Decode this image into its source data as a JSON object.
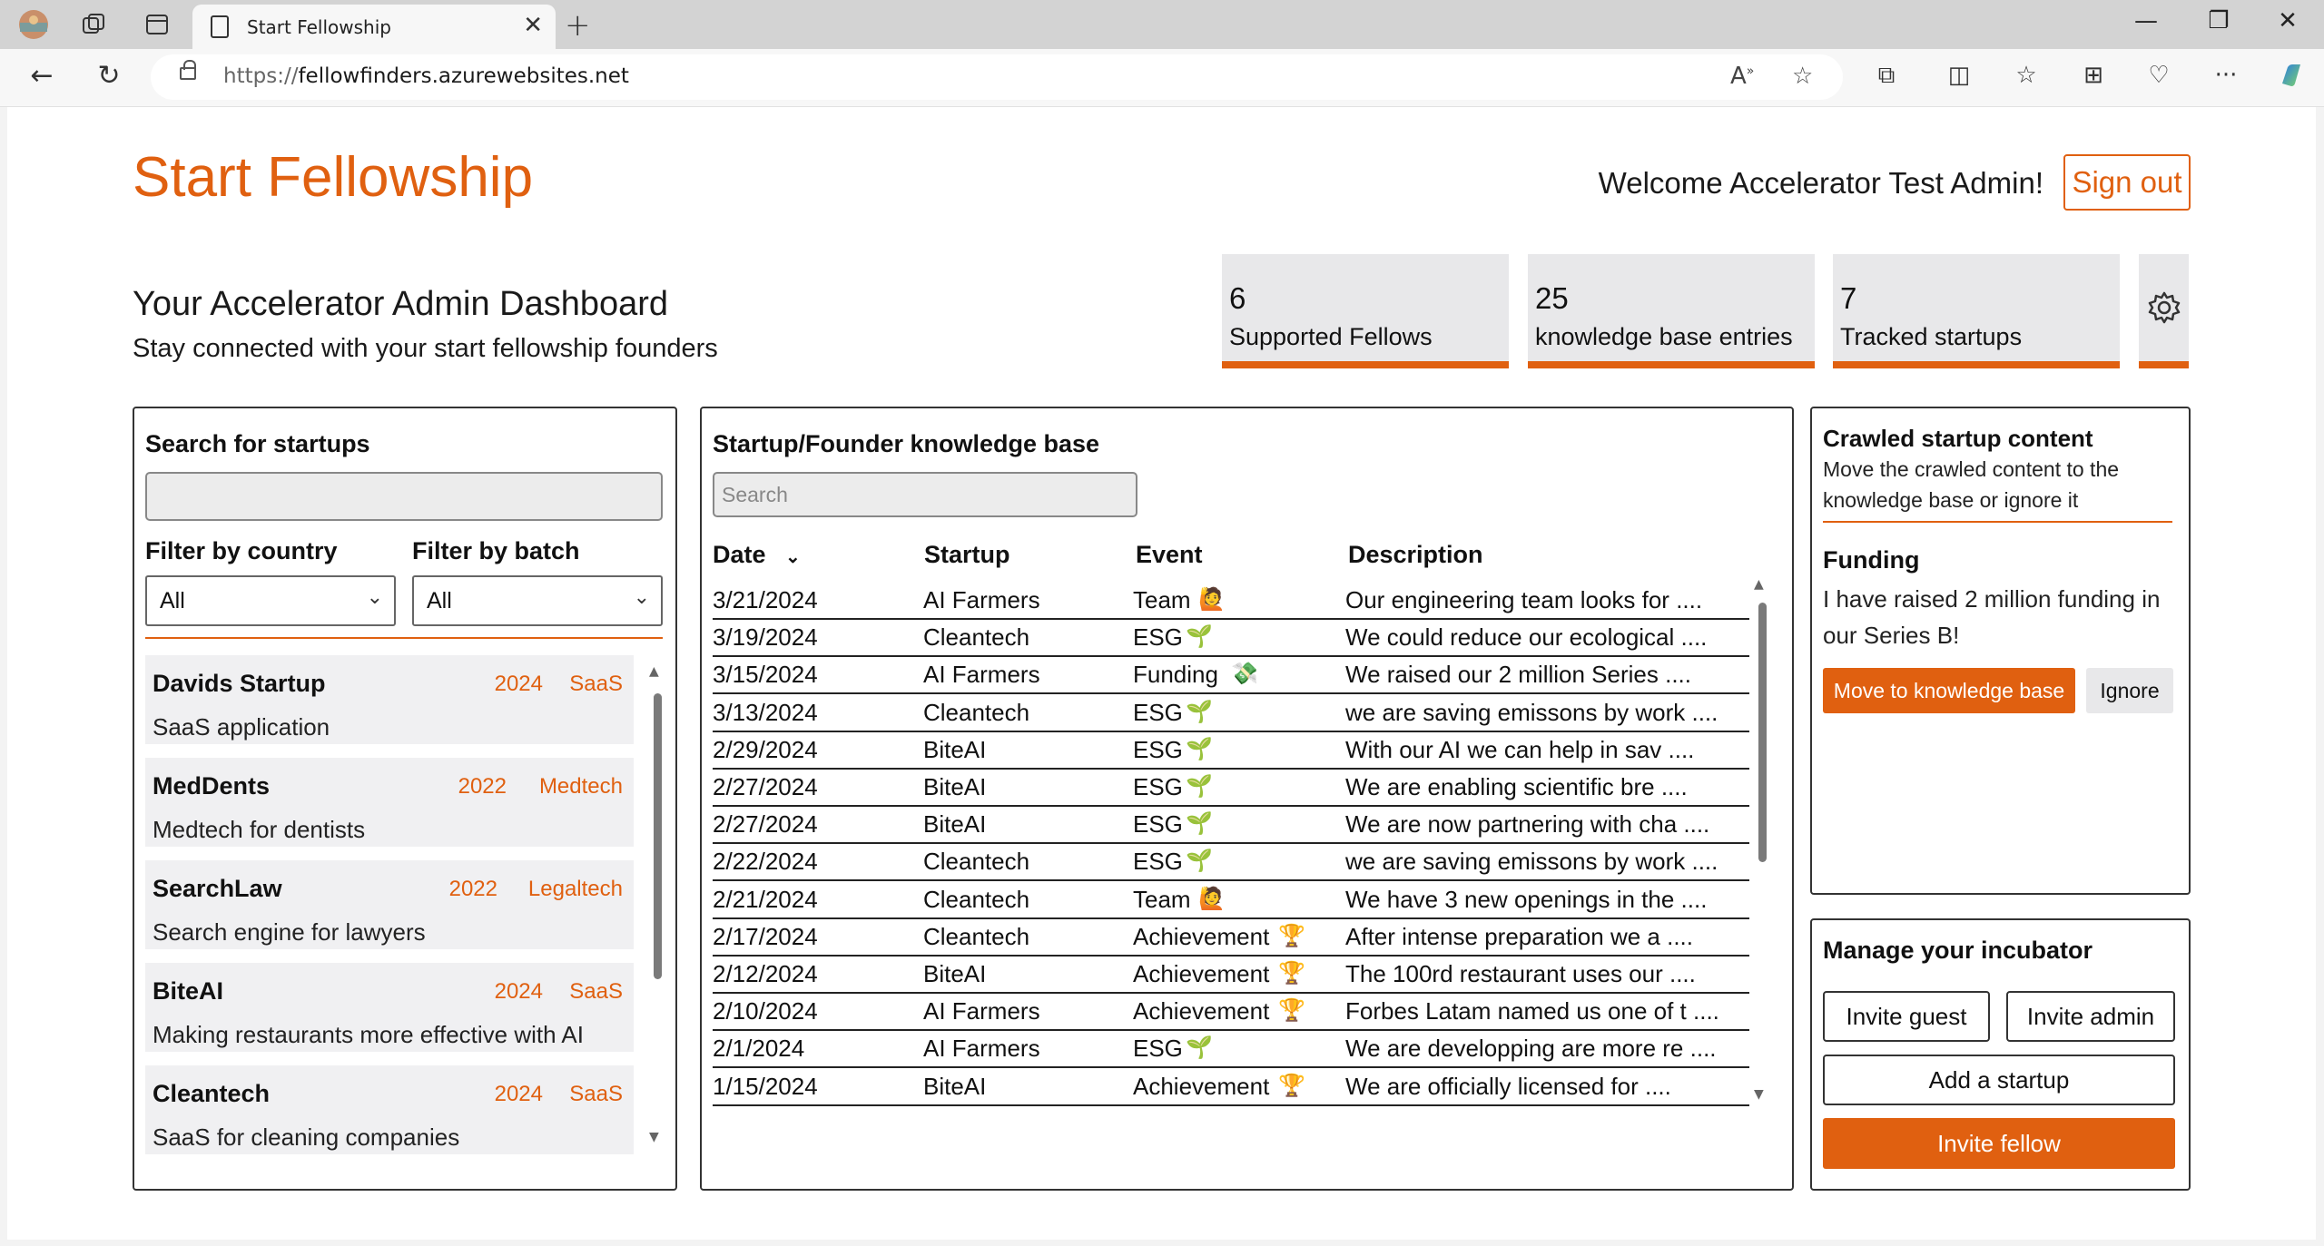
{
  "browser": {
    "tab_title": "Start Fellowship",
    "url_scheme": "https://",
    "url_host": "fellowfinders.azurewebsites.net"
  },
  "header": {
    "brand": "Start Fellowship",
    "welcome": "Welcome Accelerator Test Admin!",
    "sign_out": "Sign out"
  },
  "dashboard": {
    "title": "Your Accelerator Admin Dashboard",
    "subtitle": "Stay connected with your start fellowship founders"
  },
  "stats": [
    {
      "value": "6",
      "label": "Supported Fellows"
    },
    {
      "value": "25",
      "label": "knowledge base entries"
    },
    {
      "value": "7",
      "label": "Tracked startups"
    }
  ],
  "left_panel": {
    "title": "Search for startups",
    "search_value": "",
    "filter_country_label": "Filter by country",
    "filter_batch_label": "Filter by batch",
    "country_selected": "All",
    "batch_selected": "All",
    "startups": [
      {
        "name": "Davids Startup",
        "year": "2024",
        "category": "SaaS",
        "description": "SaaS application"
      },
      {
        "name": "MedDents",
        "year": "2022",
        "category": "Medtech",
        "description": "Medtech for dentists"
      },
      {
        "name": "SearchLaw",
        "year": "2022",
        "category": "Legaltech",
        "description": "Search engine for lawyers"
      },
      {
        "name": "BiteAI",
        "year": "2024",
        "category": "SaaS",
        "description": "Making restaurants more effective with AI"
      },
      {
        "name": "Cleantech",
        "year": "2024",
        "category": "SaaS",
        "description": "SaaS for cleaning companies"
      }
    ]
  },
  "kb_panel": {
    "title": "Startup/Founder knowledge base",
    "search_placeholder": "Search",
    "columns": {
      "date": "Date",
      "startup": "Startup",
      "event": "Event",
      "description": "Description"
    },
    "rows": [
      {
        "date": "3/21/2024",
        "startup": "AI Farmers",
        "event": "Team",
        "icon": "🙋",
        "description": "Our engineering team looks for ...."
      },
      {
        "date": "3/19/2024",
        "startup": "Cleantech",
        "event": "ESG",
        "icon": "🌱",
        "description": "We could reduce our ecological ...."
      },
      {
        "date": "3/15/2024",
        "startup": "AI Farmers",
        "event": "Funding",
        "icon": "💸",
        "description": "We raised our 2 million Series ...."
      },
      {
        "date": "3/13/2024",
        "startup": "Cleantech",
        "event": "ESG",
        "icon": "🌱",
        "description": "we are saving emissons by work ...."
      },
      {
        "date": "2/29/2024",
        "startup": "BiteAI",
        "event": "ESG",
        "icon": "🌱",
        "description": "With our AI we can help in sav ...."
      },
      {
        "date": "2/27/2024",
        "startup": "BiteAI",
        "event": "ESG",
        "icon": "🌱",
        "description": "We are enabling scientific bre ...."
      },
      {
        "date": "2/27/2024",
        "startup": "BiteAI",
        "event": "ESG",
        "icon": "🌱",
        "description": "We are now partnering with cha ...."
      },
      {
        "date": "2/22/2024",
        "startup": "Cleantech",
        "event": "ESG",
        "icon": "🌱",
        "description": "we are saving emissons by work ...."
      },
      {
        "date": "2/21/2024",
        "startup": "Cleantech",
        "event": "Team",
        "icon": "🙋",
        "description": "We have 3 new openings in the ...."
      },
      {
        "date": "2/17/2024",
        "startup": "Cleantech",
        "event": "Achievement",
        "icon": "🏆",
        "description": "After intense preparation we a ...."
      },
      {
        "date": "2/12/2024",
        "startup": "BiteAI",
        "event": "Achievement",
        "icon": "🏆",
        "description": "The 100rd restaurant uses our ...."
      },
      {
        "date": "2/10/2024",
        "startup": "AI Farmers",
        "event": "Achievement",
        "icon": "🏆",
        "description": "Forbes Latam named us one of t ...."
      },
      {
        "date": "2/1/2024",
        "startup": "AI Farmers",
        "event": "ESG",
        "icon": "🌱",
        "description": "We are developping are more re ...."
      },
      {
        "date": "1/15/2024",
        "startup": "BiteAI",
        "event": "Achievement",
        "icon": "🏆",
        "description": "We are officially licensed for ...."
      }
    ]
  },
  "crawl_panel": {
    "title": "Crawled startup content",
    "subtitle": "Move the crawled content to the knowledge base or ignore it",
    "item_label": "Funding",
    "item_text": "I have raised 2 million funding in our Series B!",
    "move_button": "Move to knowledge base",
    "ignore_button": "Ignore"
  },
  "manage_panel": {
    "title": "Manage your incubator",
    "invite_guest": "Invite guest",
    "invite_admin": "Invite admin",
    "add_startup": "Add a startup",
    "invite_fellow": "Invite fellow"
  },
  "colors": {
    "accent": "#e06010",
    "card_bg": "#f0f0f2",
    "stat_bg": "#e8e8ea"
  }
}
